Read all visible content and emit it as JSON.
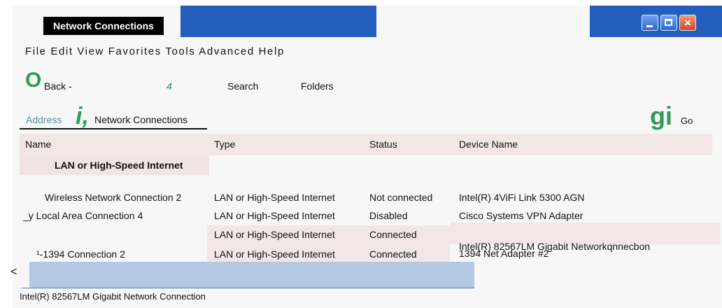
{
  "window": {
    "title": "Network Connections",
    "buttons": {
      "minimize": "minimize",
      "maximize": "maximize",
      "close": "×"
    }
  },
  "menu": {
    "text": "File Edit View Favorites Tools Advanced Help"
  },
  "toolbar": {
    "back_glyph": "O",
    "back_label": "Back -",
    "forward_number": "4",
    "search_label": "Search",
    "folders_label": "Folders"
  },
  "address": {
    "label": "Address",
    "glyph": "i,",
    "value": "Network Connections",
    "go_glyph": "gi",
    "go_label": "Go"
  },
  "list": {
    "columns": [
      "Name",
      "Type",
      "Status",
      "Device Name"
    ],
    "group": "LAN or High-Speed Internet",
    "rows": [
      {
        "name": "Wireless Network Connection 2",
        "type": "LAN or High-Speed Internet",
        "status": "Not connected",
        "device": "Intel(R) 4ViFi Link 5300 AGN"
      },
      {
        "name": "_y Local Area Connection 4",
        "type": "LAN or High-Speed Internet",
        "status": "Disabled",
        "device": "Cisco Systems VPN Adapter"
      },
      {
        "name": "",
        "type": "LAN or High-Speed Internet",
        "status": "Connected",
        "device": "Intel(R) 82567LM Gigabit Networkqnnecbon"
      },
      {
        "name": "¹-1394 Connection 2",
        "type": "LAN or High-Speed Internet",
        "status": "Connected",
        "device": "1394 Net Adapter #2"
      }
    ]
  },
  "statusbar": {
    "scroll_arrow": "<",
    "text": "Intel(R) 82567LM Gigabit Network Connection"
  },
  "colors": {
    "titlebar_blue": "#245ebd",
    "toolbar_green": "#2e9b5d",
    "header_band": "#f3e6e6",
    "scrollbar": "#b3c8e2"
  }
}
